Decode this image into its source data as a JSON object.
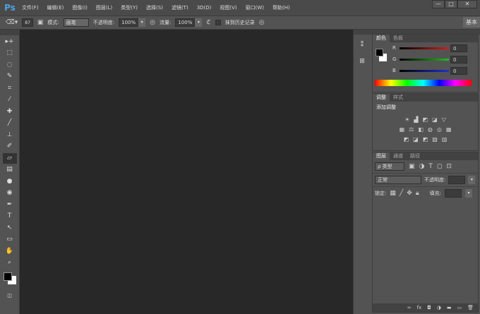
{
  "app": {
    "logo": "Ps"
  },
  "menu": [
    "文件(F)",
    "编辑(E)",
    "图像(I)",
    "图层(L)",
    "类型(Y)",
    "选择(S)",
    "滤镜(T)",
    "3D(D)",
    "视图(V)",
    "窗口(W)",
    "帮助(H)"
  ],
  "window": {
    "minimize": "—",
    "maximize": "□",
    "close": "✕"
  },
  "options": {
    "brush_size": "87",
    "mode_label": "模式:",
    "mode_value": "画笔",
    "opacity_label": "不透明度:",
    "opacity_value": "100%",
    "flow_label": "流量:",
    "flow_value": "100%",
    "history_label": "抹到历史记录",
    "workspace": "基本"
  },
  "tools": [
    "▸+",
    "⬚",
    "◌",
    "✎",
    "⌗",
    "⁄",
    "✚",
    "╱",
    "⊥",
    "✐",
    "▱",
    "▤",
    "●",
    "◉",
    "✒",
    "T",
    "↖",
    "▭",
    "✋",
    "⌕"
  ],
  "color_panel": {
    "tabs": [
      "颜色",
      "色板"
    ],
    "channels": [
      {
        "label": "R",
        "value": "0",
        "color": "#d42020"
      },
      {
        "label": "G",
        "value": "0",
        "color": "#20c020"
      },
      {
        "label": "B",
        "value": "0",
        "color": "#2030d0"
      }
    ]
  },
  "adjust_panel": {
    "tabs": [
      "调整",
      "样式"
    ],
    "title": "添加调整",
    "row1": [
      "☀",
      "▟",
      "◩",
      "◪",
      "▽"
    ],
    "row2": [
      "▦",
      "⚖",
      "◧",
      "◍",
      "◎",
      "▦"
    ],
    "row3": [
      "◩",
      "◪",
      "◩",
      "▧",
      "▥"
    ]
  },
  "layers_panel": {
    "tabs": [
      "图层",
      "通道",
      "路径"
    ],
    "filter": "ρ 类型",
    "blend": "正常",
    "opacity_label": "不透明度:",
    "lock_label": "锁定:",
    "fill_label": "填充:",
    "bottom_icons": [
      "∞",
      "fx",
      "◘",
      "◑",
      "▬",
      "▭",
      "🗑"
    ]
  }
}
